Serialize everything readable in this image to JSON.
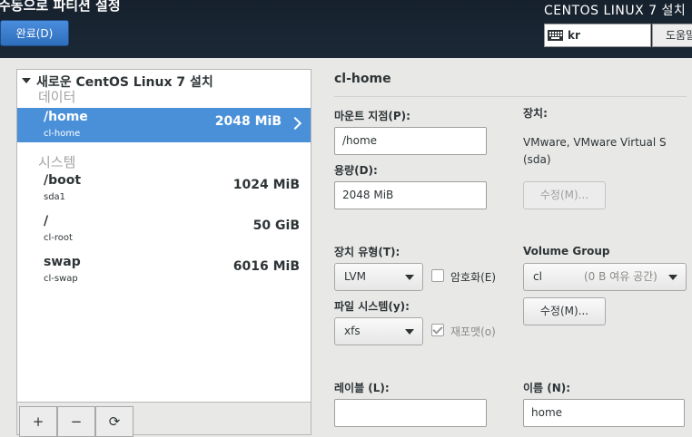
{
  "header": {
    "title": "수동으로 파티션 설정",
    "done_label": "완료(D)",
    "product": "CENTOS LINUX 7 설치",
    "keyboard_layout": "kr",
    "help_label": "도움말"
  },
  "tree": {
    "root_label": "새로운 CentOS Linux 7 설치",
    "groups": [
      {
        "label": "데이터"
      },
      {
        "label": "시스템"
      }
    ],
    "partitions": [
      {
        "mount": "/home",
        "device": "cl-home",
        "size": "2048 MiB",
        "selected": true
      },
      {
        "mount": "/boot",
        "device": "sda1",
        "size": "1024 MiB"
      },
      {
        "mount": "/",
        "device": "cl-root",
        "size": "50 GiB"
      },
      {
        "mount": "swap",
        "device": "cl-swap",
        "size": "6016 MiB"
      }
    ],
    "toolbar": {
      "add": "+",
      "remove": "−",
      "refresh": "⟳"
    }
  },
  "details": {
    "title": "cl-home",
    "mount_point_label": "마운트 지점(P):",
    "mount_point_value": "/home",
    "capacity_label": "용량(D):",
    "capacity_value": "2048 MiB",
    "device_label": "장치:",
    "device_value_line1": "VMware, VMware Virtual S",
    "device_value_line2": "(sda)",
    "device_modify_label": "수정(M)...",
    "device_type_label": "장치 유형(T):",
    "device_type_value": "LVM",
    "encrypt_label": "암호화(E)",
    "filesystem_label": "파일 시스템(y):",
    "filesystem_value": "xfs",
    "reformat_label": "재포맷(o)",
    "volume_group_label": "Volume Group",
    "volume_group_value": "cl",
    "volume_group_free": "(0 B 여유 공간)",
    "vg_modify_label": "수정(M)...",
    "label_label": "레이블 (L):",
    "label_value": "",
    "name_label": "이름 (N):",
    "name_value": "home"
  }
}
